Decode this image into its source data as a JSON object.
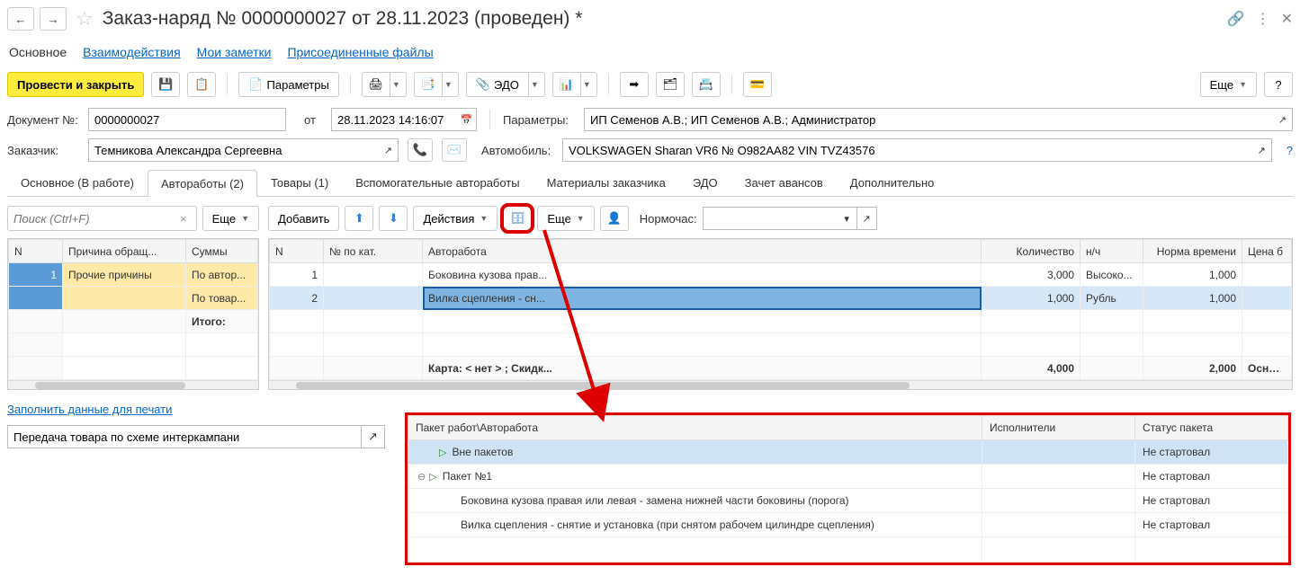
{
  "header": {
    "title": "Заказ-наряд № 0000000027  от 28.11.2023 (проведен) *"
  },
  "nav": {
    "main": "Основное",
    "inter": "Взаимодействия",
    "notes": "Мои заметки",
    "files": "Присоединенные файлы"
  },
  "toolbar": {
    "post_close": "Провести и закрыть",
    "params": "Параметры",
    "edo": "ЭДО",
    "more": "Еще",
    "help": "?"
  },
  "fields": {
    "doc_label": "Документ №:",
    "doc_value": "0000000027",
    "from_label": "от",
    "date_value": "28.11.2023 14:16:07",
    "param_label": "Параметры:",
    "param_value": "ИП Семенов А.В.; ИП Семенов А.В.; Администратор",
    "cust_label": "Заказчик:",
    "cust_value": "Темникова Александра Сергеевна",
    "car_label": "Автомобиль:",
    "car_value": "VOLKSWAGEN Sharan VR6 № О982АА82 VIN TVZ43576",
    "q": "?"
  },
  "subtabs": {
    "t1": "Основное (В работе)",
    "t2": "Автоработы (2)",
    "t3": "Товары (1)",
    "t4": "Вспомогательные автоработы",
    "t5": "Материалы заказчика",
    "t6": "ЭДО",
    "t7": "Зачет авансов",
    "t8": "Дополнительно"
  },
  "left": {
    "search_ph": "Поиск (Ctrl+F)",
    "more": "Еще",
    "cols": {
      "n": "N",
      "reason": "Причина обращ...",
      "sums": "Суммы"
    },
    "rows": [
      {
        "n": "1",
        "reason": "Прочие причины",
        "sum": "По автор..."
      },
      {
        "n": "",
        "reason": "",
        "sum": "По товар..."
      },
      {
        "n": "",
        "reason": "",
        "sum": "Итого:"
      }
    ]
  },
  "right": {
    "add": "Добавить",
    "actions": "Действия",
    "more": "Еще",
    "norm_label": "Нормочас:",
    "cols": {
      "n": "N",
      "cat": "№ по кат.",
      "work": "Авторабота",
      "qty": "Количество",
      "nh": "н/ч",
      "time": "Норма времени",
      "price": "Цена б"
    },
    "rows": [
      {
        "n": "1",
        "cat": "",
        "work": "Боковина кузова прав...",
        "qty": "3,000",
        "nh": "Высоко...",
        "time": "1,000",
        "price": ""
      },
      {
        "n": "2",
        "cat": "",
        "work": "Вилка сцепления - сн...",
        "qty": "1,000",
        "nh": "Рубль",
        "time": "1,000",
        "price": ""
      }
    ],
    "footer": {
      "work": "Карта: < нет > ; Скидк...",
      "qty": "4,000",
      "time": "2,000",
      "price": "Основн"
    }
  },
  "bottom": {
    "print_link": "Заполнить данные для печати",
    "transfer": "Передача товара по схеме интеркампани"
  },
  "detail": {
    "cols": {
      "pack": "Пакет работ\\Авторабота",
      "exec": "Исполнители",
      "status": "Статус пакета"
    },
    "rows": [
      {
        "indent": 1,
        "tri": true,
        "name": "Вне пакетов",
        "exec": "",
        "status": "Не стартовал",
        "sel": true
      },
      {
        "indent": 0,
        "exp": true,
        "tri": true,
        "name": "Пакет №1",
        "exec": "",
        "status": "Не стартовал"
      },
      {
        "indent": 2,
        "name": "Боковина кузова правая или левая - замена нижней части боковины (порога)",
        "exec": "",
        "status": "Не стартовал"
      },
      {
        "indent": 2,
        "name": "Вилка сцепления - снятие и установка (при снятом рабочем цилиндре сцепления)",
        "exec": "",
        "status": "Не стартовал"
      }
    ]
  }
}
